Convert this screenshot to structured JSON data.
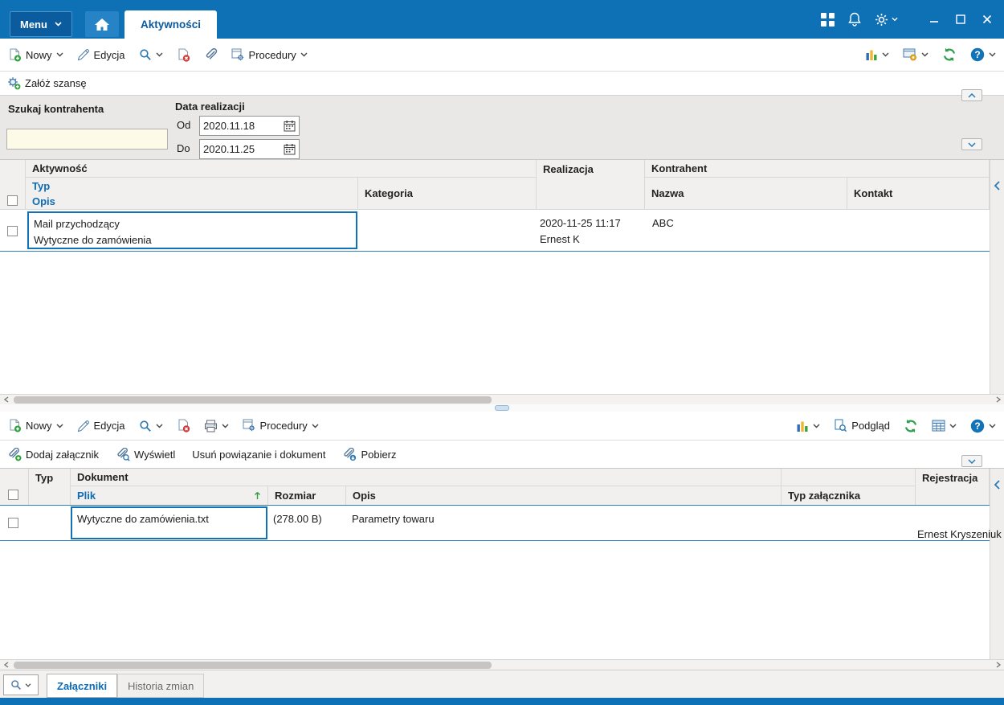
{
  "colors": {
    "accent": "#0e70b5",
    "green": "#2fa03c",
    "red": "#d23b3b",
    "yellow": "#f2b52b"
  },
  "titlebar": {
    "menu_label": "Menu",
    "active_tab": "Aktywności"
  },
  "toolbars": {
    "top": {
      "new": "Nowy",
      "edit": "Edycja",
      "procedures": "Procedury"
    },
    "bottom": {
      "new": "Nowy",
      "edit": "Edycja",
      "procedures": "Procedury",
      "preview": "Podgląd"
    }
  },
  "shortcuts": {
    "create_opportunity": "Załóż szansę",
    "add_attachment": "Dodaj załącznik",
    "show_attachment": "Wyświetl",
    "remove_link_and_document": "Usuń powiązanie i dokument",
    "download": "Pobierz"
  },
  "filters": {
    "search_label": "Szukaj kontrahenta",
    "search_value": "",
    "date_label": "Data realizacji",
    "from_label": "Od",
    "from_value": "2020.11.18",
    "to_label": "Do",
    "to_value": "2020.11.25"
  },
  "activities": {
    "headers": {
      "activity": "Aktywność",
      "type": "Typ",
      "description": "Opis",
      "category": "Kategoria",
      "realization": "Realizacja",
      "contractor": "Kontrahent",
      "name": "Nazwa",
      "contact": "Kontakt"
    },
    "rows": [
      {
        "type": "Mail przychodzący",
        "description": "Wytyczne do zamówienia",
        "category": "",
        "realization_date": "2020-11-25 11:17",
        "realization_user": "Ernest K",
        "contractor_name": "ABC",
        "contact": ""
      }
    ]
  },
  "attachments": {
    "headers": {
      "type": "Typ",
      "document": "Dokument",
      "file": "Plik",
      "size": "Rozmiar",
      "description": "Opis",
      "attachment_type": "Typ załącznika",
      "registration": "Rejestracja"
    },
    "rows": [
      {
        "file": "Wytyczne do zamówienia.txt",
        "size": "(278.00 B)",
        "description": "Parametry towaru",
        "attachment_type": "",
        "registered_by": "Ernest Kryszeniuk"
      }
    ]
  },
  "bottom_tabs": {
    "attachments": "Załączniki",
    "history": "Historia zmian"
  }
}
